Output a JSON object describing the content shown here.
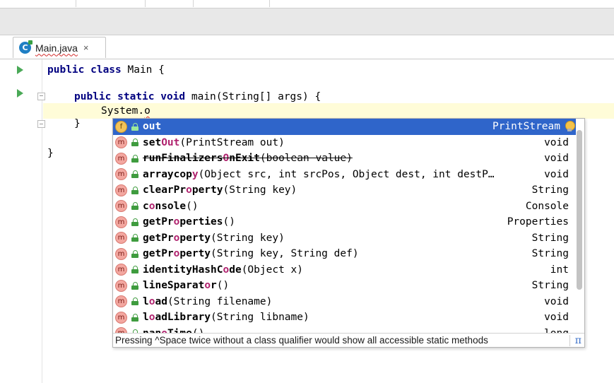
{
  "tab": {
    "label": "Main.java",
    "close": "×",
    "icon": "java-class-icon"
  },
  "code": {
    "line1": {
      "kw": "public class",
      "rest": " Main {"
    },
    "line2": {
      "kw": "public static void",
      "rest": " main(String[] args) {"
    },
    "line3": {
      "prefix": "System.",
      "typed": "o"
    },
    "line4": "}",
    "line5": "}"
  },
  "completion": {
    "items": [
      {
        "kind": "f",
        "pre": "",
        "hl": "out",
        "post": "",
        "params": "",
        "ret": "PrintStream",
        "selected": true,
        "deprecated": false
      },
      {
        "kind": "m",
        "pre": "set",
        "hl": "Out",
        "post": "",
        "params": "(PrintStream out)",
        "ret": "void",
        "selected": false,
        "deprecated": false
      },
      {
        "kind": "m",
        "pre": "runFinalizers",
        "hl": "O",
        "post": "nExit",
        "params": "(boolean value)",
        "ret": "void",
        "selected": false,
        "deprecated": true
      },
      {
        "kind": "m",
        "pre": "arraycop",
        "hl": "y",
        "post": "",
        "params": "(Object src, int srcPos, Object dest, int destP…",
        "ret": "void",
        "selected": false,
        "deprecated": false
      },
      {
        "kind": "m",
        "pre": "clearPr",
        "hl": "o",
        "post": "perty",
        "params": "(String key)",
        "ret": "String",
        "selected": false,
        "deprecated": false
      },
      {
        "kind": "m",
        "pre": "c",
        "hl": "o",
        "post": "nsole",
        "params": "()",
        "ret": "Console",
        "selected": false,
        "deprecated": false
      },
      {
        "kind": "m",
        "pre": "getPr",
        "hl": "o",
        "post": "perties",
        "params": "()",
        "ret": "Properties",
        "selected": false,
        "deprecated": false
      },
      {
        "kind": "m",
        "pre": "getPr",
        "hl": "o",
        "post": "perty",
        "params": "(String key)",
        "ret": "String",
        "selected": false,
        "deprecated": false
      },
      {
        "kind": "m",
        "pre": "getPr",
        "hl": "o",
        "post": "perty",
        "params": "(String key, String def)",
        "ret": "String",
        "selected": false,
        "deprecated": false
      },
      {
        "kind": "m",
        "pre": "identityHashC",
        "hl": "o",
        "post": "de",
        "params": "(Object x)",
        "ret": "int",
        "selected": false,
        "deprecated": false
      },
      {
        "kind": "m",
        "pre": "lineSparat",
        "hl": "o",
        "post": "r",
        "params": "()",
        "ret": "String",
        "selected": false,
        "deprecated": false
      },
      {
        "kind": "m",
        "pre": "l",
        "hl": "o",
        "post": "ad",
        "params": "(String filename)",
        "ret": "void",
        "selected": false,
        "deprecated": false
      },
      {
        "kind": "m",
        "pre": "l",
        "hl": "o",
        "post": "adLibrary",
        "params": "(String libname)",
        "ret": "void",
        "selected": false,
        "deprecated": false
      },
      {
        "kind": "m",
        "pre": "nan",
        "hl": "o",
        "post": "Time",
        "params": "()",
        "ret": "long",
        "selected": false,
        "deprecated": false
      }
    ],
    "hint": "Pressing ^Space twice without a class qualifier would show all accessible static methods",
    "hint_icon": "π"
  },
  "colors": {
    "selection": "#2f65ca",
    "keyword": "#000080",
    "match": "#b0226e",
    "current_line": "#fffcd8"
  }
}
